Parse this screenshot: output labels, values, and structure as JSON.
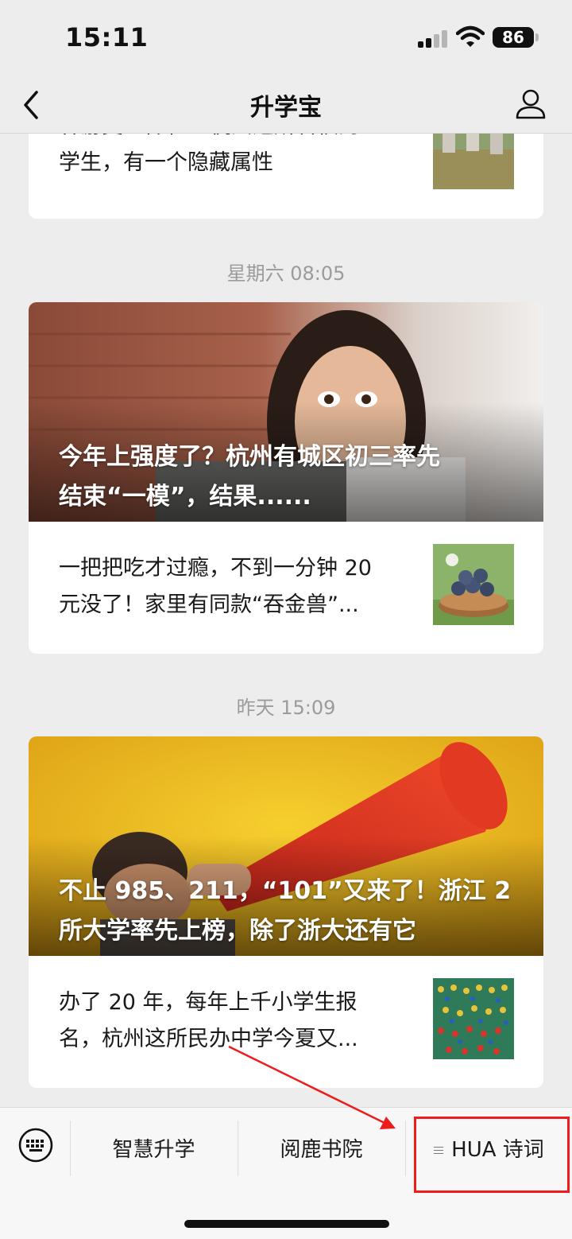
{
  "status_bar": {
    "time": "15:11",
    "battery": "86"
  },
  "nav": {
    "title": "升学宝"
  },
  "feed": {
    "top_partial": {
      "text_line1": "春游变“斗舞”！杭州这所名校的",
      "text_line2": "学生，有一个隐藏属性"
    },
    "groups": [
      {
        "timestamp": "星期六 08:05",
        "hero_title_line1": "今年上强度了？杭州有城区初三率先",
        "hero_title_line2": "结束“一模”，结果......",
        "item_line1": "一把把吃才过瘾，不到一分钟 20",
        "item_line2": "元没了！家里有同款“吞金兽”..."
      },
      {
        "timestamp": "昨天 15:09",
        "hero_title_line1": "不止 985、211，“101”又来了！浙江 2",
        "hero_title_line2": "所大学率先上榜，除了浙大还有它",
        "item_line1": "办了 20 年，每年上千小学生报",
        "item_line2": "名，杭州这所民办中学今夏又..."
      }
    ]
  },
  "menu": {
    "keyboard_icon": "keyboard-icon",
    "items": [
      {
        "label": "智慧升学"
      },
      {
        "label": "阅鹿书院"
      },
      {
        "label": "HUA 诗词"
      }
    ]
  },
  "annotation": {
    "color": "#ee1c1c"
  }
}
